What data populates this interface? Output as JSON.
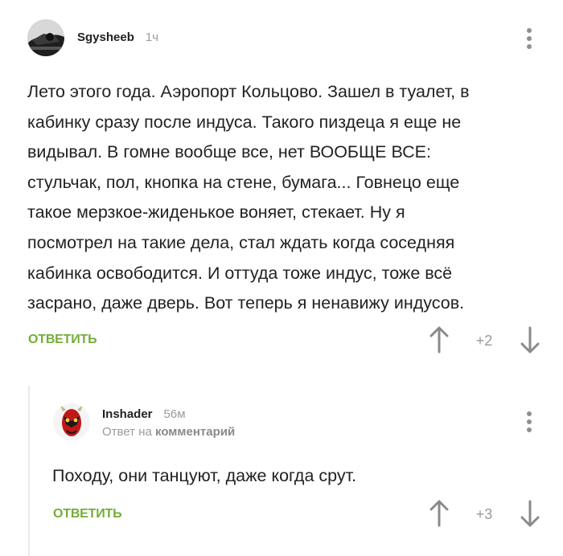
{
  "comment1": {
    "username": "Sgysheeb",
    "time": "1ч",
    "text_lines": [
      "Лето этого года. Аэропорт Кольцово. Зашел в туалет, в",
      "кабинку сразу после индуса. Такого пиздеца я еще не",
      "видывал. В гомне вообще все, нет ВООБЩЕ ВСЕ:",
      "стульчак, пол, кнопка на стене, бумага... Говнецо еще",
      "такое мерзкое-жиденькое воняет, стекает. Ну я",
      "посмотрел на такие дела, стал ждать когда соседняя",
      "кабинка освободится. И оттуда тоже индус, тоже всё",
      "засрано, даже дверь. Вот теперь я ненавижу индусов."
    ],
    "reply_label": "ОТВЕТИТЬ",
    "score": "+2"
  },
  "comment2": {
    "username": "Inshader",
    "time": "56м",
    "answer_prefix": "Ответ на",
    "answer_target": "комментарий",
    "text_lines": [
      "Походу, они танцуют, даже когда срут."
    ],
    "reply_label": "ОТВЕТИТЬ",
    "score": "+3"
  },
  "colors": {
    "accent": "#74ad38",
    "muted": "#9a9a9a",
    "text": "#222222"
  },
  "icons": {
    "more": "kebab-menu-icon",
    "up": "arrow-up-icon",
    "down": "arrow-down-icon"
  }
}
